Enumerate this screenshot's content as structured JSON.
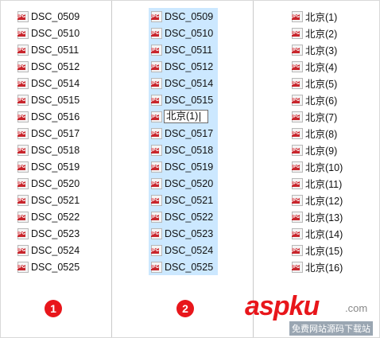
{
  "panel1": {
    "files": [
      "DSC_0509",
      "DSC_0510",
      "DSC_0511",
      "DSC_0512",
      "DSC_0514",
      "DSC_0515",
      "DSC_0516",
      "DSC_0517",
      "DSC_0518",
      "DSC_0519",
      "DSC_0520",
      "DSC_0521",
      "DSC_0522",
      "DSC_0523",
      "DSC_0524",
      "DSC_0525"
    ],
    "badge": "1"
  },
  "panel2": {
    "files_before": [
      "DSC_0509",
      "DSC_0510",
      "DSC_0511",
      "DSC_0512",
      "DSC_0514",
      "DSC_0515"
    ],
    "rename_value": "北京(1)",
    "files_after": [
      "DSC_0517",
      "DSC_0518",
      "DSC_0519",
      "DSC_0520",
      "DSC_0521",
      "DSC_0522",
      "DSC_0523",
      "DSC_0524",
      "DSC_0525"
    ],
    "badge": "2",
    "selection_color": "#cce8ff"
  },
  "panel3": {
    "files": [
      "北京(1)",
      "北京(2)",
      "北京(3)",
      "北京(4)",
      "北京(5)",
      "北京(6)",
      "北京(7)",
      "北京(8)",
      "北京(9)",
      "北京(10)",
      "北京(11)",
      "北京(12)",
      "北京(13)",
      "北京(14)",
      "北京(15)",
      "北京(16)"
    ]
  },
  "icons": {
    "file_icon": "jpg-file-icon"
  },
  "colors": {
    "badge": "#e8161b",
    "selection": "#cce8ff"
  },
  "watermark": {
    "brand": "aspku",
    "domain_suffix": ".com",
    "subtitle": "免费网站源码下载站"
  }
}
